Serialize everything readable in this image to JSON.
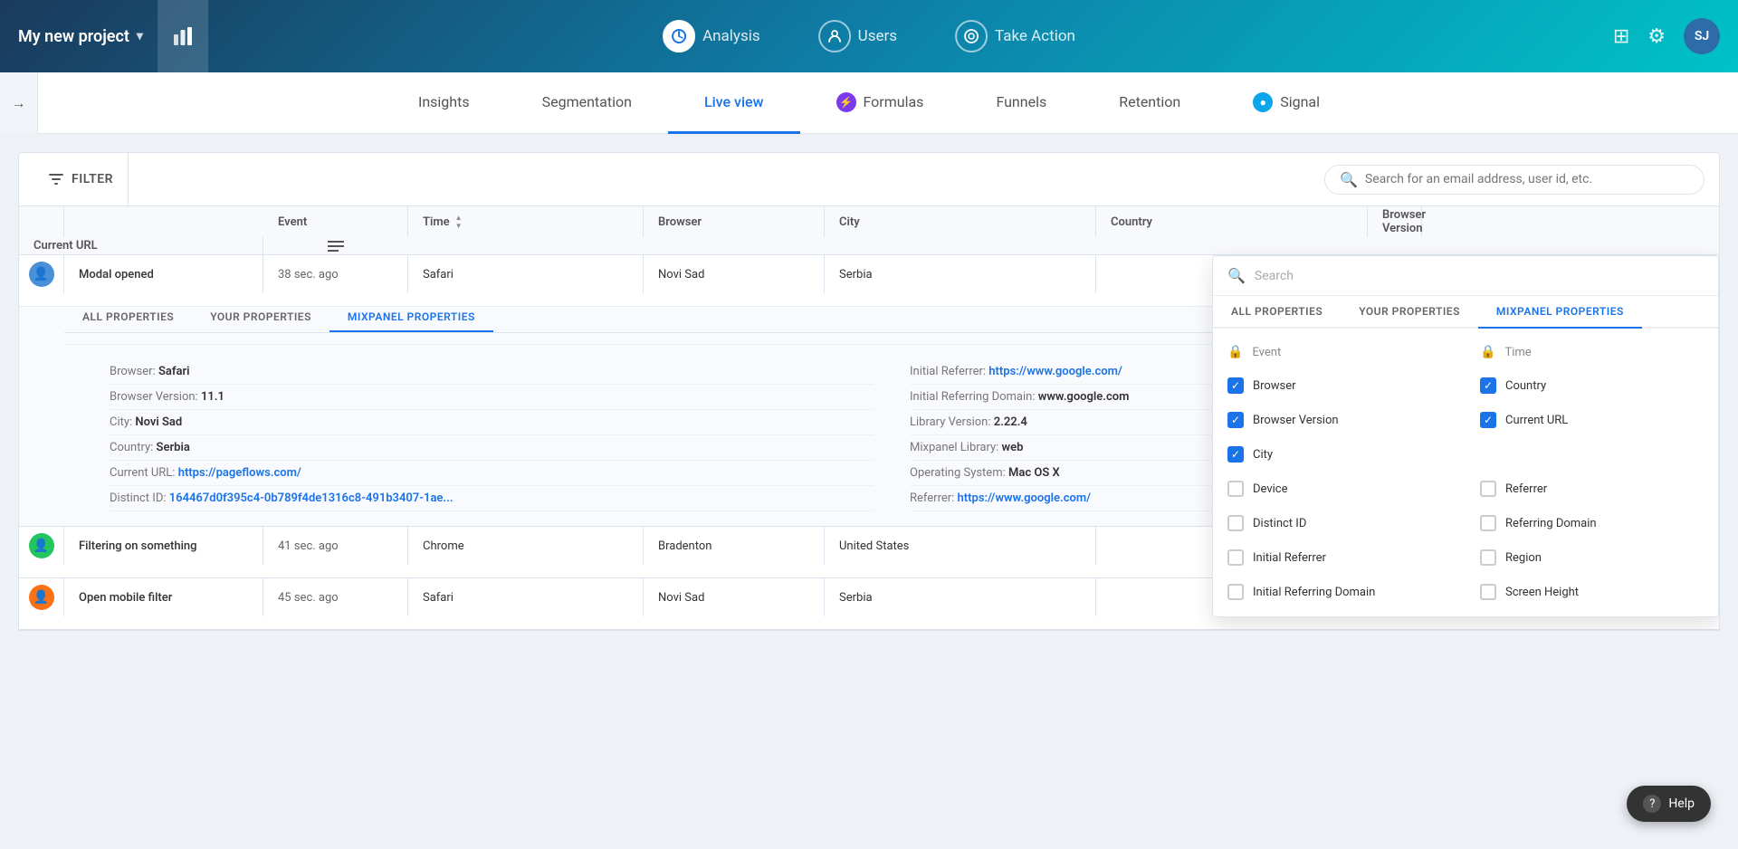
{
  "app": {
    "project_name": "My new project",
    "nav": {
      "analysis_label": "Analysis",
      "users_label": "Users",
      "take_action_label": "Take Action",
      "grid_icon": "⊞",
      "gear_icon": "⚙",
      "avatar_initials": "SJ"
    },
    "sub_nav": [
      {
        "id": "insights",
        "label": "Insights",
        "active": false,
        "badge": null
      },
      {
        "id": "segmentation",
        "label": "Segmentation",
        "active": false,
        "badge": null
      },
      {
        "id": "live-view",
        "label": "Live view",
        "active": true,
        "badge": null
      },
      {
        "id": "formulas",
        "label": "Formulas",
        "active": false,
        "badge": "purple"
      },
      {
        "id": "funnels",
        "label": "Funnels",
        "active": false,
        "badge": null
      },
      {
        "id": "retention",
        "label": "Retention",
        "active": false,
        "badge": null
      },
      {
        "id": "signal",
        "label": "Signal",
        "active": false,
        "badge": "teal"
      }
    ]
  },
  "filter_bar": {
    "filter_label": "FILTER",
    "search_placeholder": "Search for an email address, user id, etc."
  },
  "table": {
    "columns": [
      {
        "id": "event",
        "label": "Event"
      },
      {
        "id": "time",
        "label": "Time",
        "sortable": true
      },
      {
        "id": "browser",
        "label": "Browser"
      },
      {
        "id": "city",
        "label": "City"
      },
      {
        "id": "country",
        "label": "Country"
      },
      {
        "id": "browser_version",
        "label": "Browser Version"
      },
      {
        "id": "current_url",
        "label": "Current URL"
      },
      {
        "id": "col_picker",
        "label": ""
      }
    ],
    "rows": [
      {
        "id": 1,
        "avatar_color": "blue",
        "event": "Modal opened",
        "time": "38 sec. ago",
        "browser": "Safari",
        "city": "Novi Sad",
        "country": "Serbia",
        "browser_version": "",
        "current_url": "",
        "expanded": true,
        "properties_tabs": [
          "ALL PROPERTIES",
          "YOUR PROPERTIES",
          "MIXPANEL PROPERTIES"
        ],
        "active_tab": "MIXPANEL PROPERTIES",
        "props_left": [
          {
            "key": "Browser:",
            "val": "Safari",
            "bold": true
          },
          {
            "key": "Browser Version:",
            "val": "11.1",
            "bold": true
          },
          {
            "key": "City:",
            "val": "Novi Sad",
            "bold": true
          },
          {
            "key": "Country:",
            "val": "Serbia",
            "bold": true
          },
          {
            "key": "Current URL:",
            "val": "https://pageflows.com/",
            "bold": true,
            "link": true
          },
          {
            "key": "Distinct ID:",
            "val": "164467d0f395c4-0b789f4de1316c8-491b3407-1ae...",
            "bold": true,
            "link": true
          }
        ],
        "props_right": [
          {
            "key": "Initial Referrer:",
            "val": "https://www.google.com/",
            "bold": true,
            "link": true
          },
          {
            "key": "Initial Referring Domain:",
            "val": "www.google.com",
            "bold": true
          },
          {
            "key": "Library Version:",
            "val": "2.22.4",
            "bold": true
          },
          {
            "key": "Mixpanel Library:",
            "val": "web",
            "bold": true
          },
          {
            "key": "Operating System:",
            "val": "Mac OS X",
            "bold": true
          },
          {
            "key": "Referrer:",
            "val": "https://www.google.com/",
            "bold": true,
            "link": true
          }
        ]
      },
      {
        "id": 2,
        "avatar_color": "green",
        "event": "Filtering on something",
        "time": "41 sec. ago",
        "browser": "Chrome",
        "city": "Bradenton",
        "country": "United States",
        "browser_version": "",
        "current_url": "",
        "expanded": false
      },
      {
        "id": 3,
        "avatar_color": "orange",
        "event": "Open mobile filter",
        "time": "45 sec. ago",
        "browser": "Safari",
        "city": "Novi Sad",
        "country": "Serbia",
        "browser_version": "",
        "current_url": "",
        "expanded": false
      }
    ]
  },
  "col_picker": {
    "search_placeholder": "Search",
    "tabs": [
      "ALL PROPERTIES",
      "YOUR PROPERTIES",
      "MIXPANEL PROPERTIES"
    ],
    "active_tab": "MIXPANEL PROPERTIES",
    "items": [
      {
        "id": "event",
        "label": "Event",
        "locked": true,
        "checked": false
      },
      {
        "id": "time",
        "label": "Time",
        "locked": true,
        "checked": false
      },
      {
        "id": "browser",
        "label": "Browser",
        "locked": false,
        "checked": true
      },
      {
        "id": "country",
        "label": "Country",
        "locked": false,
        "checked": true
      },
      {
        "id": "browser_version",
        "label": "Browser Version",
        "locked": false,
        "checked": true
      },
      {
        "id": "current_url",
        "label": "Current URL",
        "locked": false,
        "checked": true
      },
      {
        "id": "city",
        "label": "City",
        "locked": false,
        "checked": true
      },
      {
        "id": "empty1",
        "label": "",
        "locked": false,
        "checked": false
      },
      {
        "id": "device",
        "label": "Device",
        "locked": false,
        "checked": false
      },
      {
        "id": "referrer",
        "label": "Referrer",
        "locked": false,
        "checked": false
      },
      {
        "id": "distinct_id",
        "label": "Distinct ID",
        "locked": false,
        "checked": false
      },
      {
        "id": "referring_domain",
        "label": "Referring Domain",
        "locked": false,
        "checked": false
      },
      {
        "id": "initial_referrer",
        "label": "Initial Referrer",
        "locked": false,
        "checked": false
      },
      {
        "id": "region",
        "label": "Region",
        "locked": false,
        "checked": false
      },
      {
        "id": "initial_referring_domain",
        "label": "Initial Referring Domain",
        "locked": false,
        "checked": false
      },
      {
        "id": "screen_height",
        "label": "Screen Height",
        "locked": false,
        "checked": false
      }
    ]
  },
  "help": {
    "label": "Help",
    "icon": "?"
  }
}
